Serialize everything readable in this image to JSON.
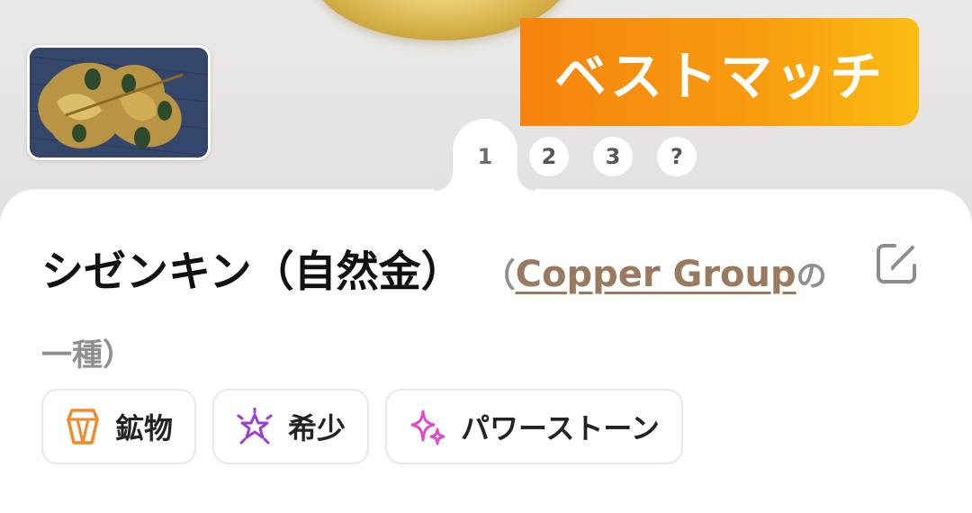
{
  "header": {
    "badge_text": "ベストマッチ",
    "badge_colors": [
      "#f5830e",
      "#fbbd12"
    ]
  },
  "tabs": [
    {
      "label": "1",
      "active": true
    },
    {
      "label": "2",
      "active": false
    },
    {
      "label": "3",
      "active": false
    },
    {
      "label": "?",
      "active": false
    }
  ],
  "result": {
    "name": "シゼンキン（自然金）",
    "paren_open": "（",
    "group_link": "Copper Group",
    "group_suffix": "の一種）"
  },
  "chips": [
    {
      "label": "鉱物",
      "icon": "crystal-icon",
      "color": "#f08a2c"
    },
    {
      "label": "希少",
      "icon": "sparkle-burst-icon",
      "color": "#9b3fd6"
    },
    {
      "label": "パワーストーン",
      "icon": "sparkles-icon",
      "color": "#e04ac8"
    }
  ],
  "icons": {
    "edit": "edit-icon"
  }
}
